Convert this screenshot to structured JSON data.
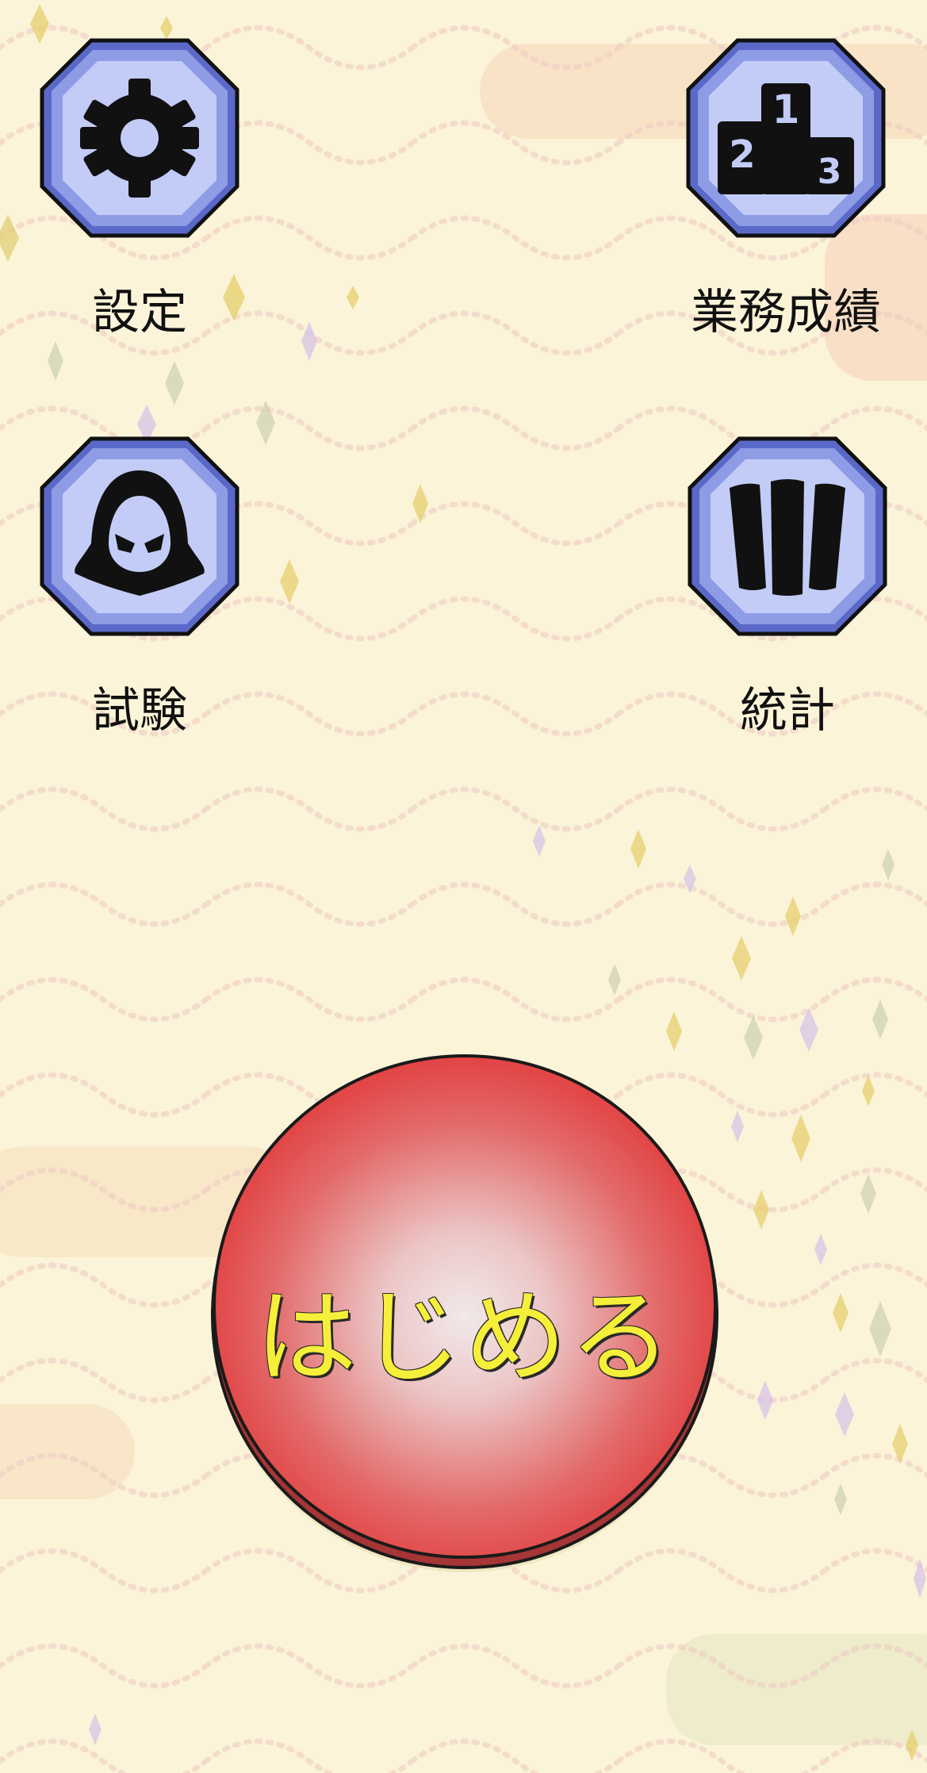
{
  "menu": {
    "settings": {
      "label": "設定",
      "icon": "gear-icon"
    },
    "records": {
      "label": "業務成績",
      "icon": "podium-icon",
      "podium_numbers": [
        "1",
        "2",
        "3"
      ]
    },
    "exam": {
      "label": "試験",
      "icon": "hooded-figure-icon"
    },
    "stats": {
      "label": "統計",
      "icon": "cards-icon"
    }
  },
  "start_button": {
    "label": "はじめる"
  },
  "colors": {
    "background": "#fcf4d8",
    "icon_tile": "#bcc6f5",
    "icon_tile_border": "#5a69c8",
    "start_button": "#e23a3a",
    "start_label": "#f6ef3a"
  }
}
